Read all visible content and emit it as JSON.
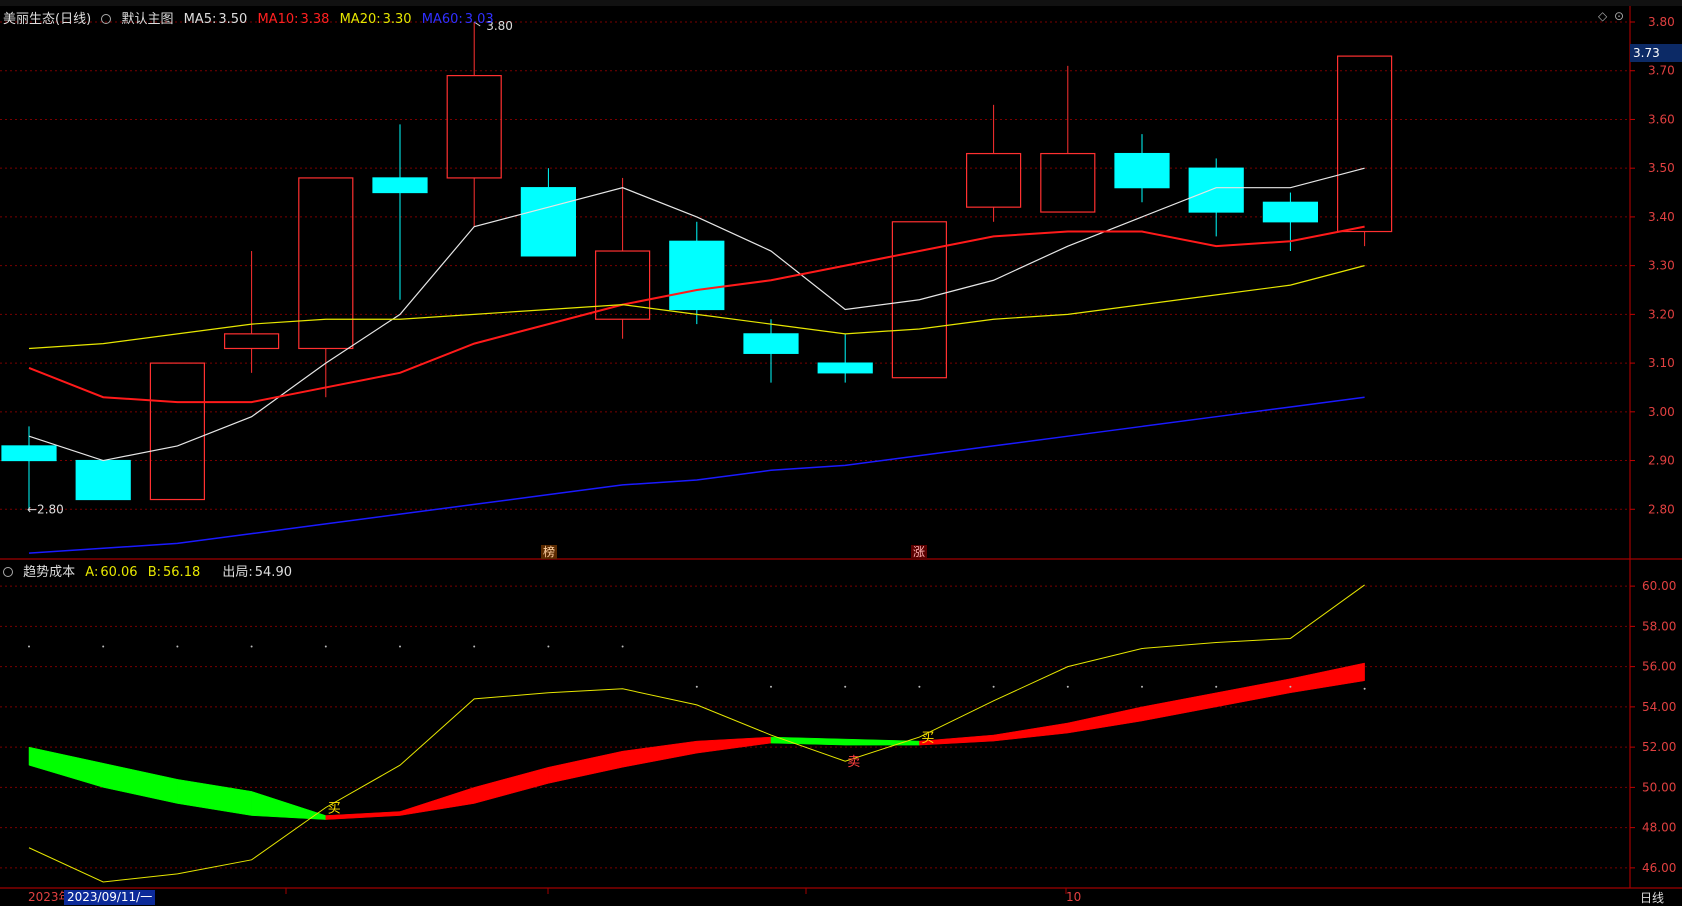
{
  "top_header": {
    "stock": "美丽生态(日线)",
    "template": "默认主图",
    "ma5_label": "MA5:",
    "ma5": "3.50",
    "ma10_label": "MA10:",
    "ma10": "3.38",
    "ma20_label": "MA20:",
    "ma20": "3.30",
    "ma60_label": "MA60:",
    "ma60": "3.03"
  },
  "bottom_header": {
    "indicator": "趋势成本",
    "a_label": "A:",
    "a": "60.06",
    "b_label": "B:",
    "b": "56.18",
    "exit_label": "出局:",
    "exit": "54.90"
  },
  "current_price_tag": "3.73",
  "date_labels": {
    "year_left": "2023年",
    "selected_date": "2023/09/11/一",
    "month_mark": "10"
  },
  "period_button": "日线",
  "annotations": {
    "high": "3.80",
    "low": "2.80",
    "mark1": "榜",
    "mark2": "涨"
  },
  "colors": {
    "up": "#ff3030",
    "down": "#00ffff",
    "ma5": "#e6e6e6",
    "ma10": "#ff1a1a",
    "ma20": "#e6e600",
    "ma60": "#1a1aff",
    "band_up": "#ff0000",
    "band_down": "#00ff00",
    "grid": "#7a0000",
    "axis_text": "#e04040"
  },
  "chart_data": [
    {
      "type": "candlestick",
      "title": "美丽生态(日线)",
      "ylim": [
        2.7,
        3.8
      ],
      "y_ticks": [
        "3.80",
        "3.70",
        "3.60",
        "3.50",
        "3.40",
        "3.30",
        "3.20",
        "3.10",
        "3.00",
        "2.90",
        "2.80"
      ],
      "candles": [
        {
          "open": 2.93,
          "close": 2.9,
          "high": 2.97,
          "low": 2.8
        },
        {
          "open": 2.9,
          "close": 2.82,
          "high": 2.9,
          "low": 2.82
        },
        {
          "open": 2.82,
          "close": 3.1,
          "high": 3.1,
          "low": 2.82
        },
        {
          "open": 3.13,
          "close": 3.16,
          "high": 3.33,
          "low": 3.08
        },
        {
          "open": 3.13,
          "close": 3.48,
          "high": 3.48,
          "low": 3.03
        },
        {
          "open": 3.48,
          "close": 3.45,
          "high": 3.59,
          "low": 3.23
        },
        {
          "open": 3.48,
          "close": 3.69,
          "high": 3.8,
          "low": 3.38
        },
        {
          "open": 3.46,
          "close": 3.32,
          "high": 3.5,
          "low": 3.32
        },
        {
          "open": 3.19,
          "close": 3.33,
          "high": 3.48,
          "low": 3.15
        },
        {
          "open": 3.35,
          "close": 3.21,
          "high": 3.39,
          "low": 3.18
        },
        {
          "open": 3.16,
          "close": 3.12,
          "high": 3.19,
          "low": 3.06
        },
        {
          "open": 3.1,
          "close": 3.08,
          "high": 3.16,
          "low": 3.06
        },
        {
          "open": 3.07,
          "close": 3.39,
          "high": 3.39,
          "low": 3.07
        },
        {
          "open": 3.42,
          "close": 3.53,
          "high": 3.63,
          "low": 3.39
        },
        {
          "open": 3.41,
          "close": 3.53,
          "high": 3.71,
          "low": 3.41
        },
        {
          "open": 3.53,
          "close": 3.46,
          "high": 3.57,
          "low": 3.43
        },
        {
          "open": 3.5,
          "close": 3.41,
          "high": 3.52,
          "low": 3.36
        },
        {
          "open": 3.43,
          "close": 3.39,
          "high": 3.45,
          "low": 3.33
        },
        {
          "open": 3.37,
          "close": 3.73,
          "high": 3.73,
          "low": 3.34
        }
      ],
      "series": [
        {
          "name": "MA5",
          "values": [
            2.95,
            2.9,
            2.93,
            2.99,
            3.1,
            3.2,
            3.38,
            3.42,
            3.46,
            3.4,
            3.33,
            3.21,
            3.23,
            3.27,
            3.34,
            3.4,
            3.46,
            3.46,
            3.5
          ]
        },
        {
          "name": "MA10",
          "values": [
            3.09,
            3.03,
            3.02,
            3.02,
            3.05,
            3.08,
            3.14,
            3.18,
            3.22,
            3.25,
            3.27,
            3.3,
            3.33,
            3.36,
            3.37,
            3.37,
            3.34,
            3.35,
            3.38
          ]
        },
        {
          "name": "MA20",
          "values": [
            3.13,
            3.14,
            3.16,
            3.18,
            3.19,
            3.19,
            3.2,
            3.21,
            3.22,
            3.2,
            3.18,
            3.16,
            3.17,
            3.19,
            3.2,
            3.22,
            3.24,
            3.26,
            3.3
          ]
        },
        {
          "name": "MA60",
          "values": [
            2.71,
            2.72,
            2.73,
            2.75,
            2.77,
            2.79,
            2.81,
            2.83,
            2.85,
            2.86,
            2.88,
            2.89,
            2.91,
            2.93,
            2.95,
            2.97,
            2.99,
            3.01,
            3.03
          ]
        }
      ]
    },
    {
      "type": "line",
      "title": "趋势成本",
      "ylim": [
        45,
        61
      ],
      "y_ticks": [
        "60.00",
        "58.00",
        "56.00",
        "54.00",
        "52.00",
        "50.00",
        "48.00",
        "46.00"
      ],
      "series": [
        {
          "name": "A",
          "values": [
            47.0,
            45.3,
            45.7,
            46.4,
            49.0,
            51.1,
            54.4,
            54.7,
            54.9,
            54.1,
            52.6,
            51.3,
            52.5,
            54.3,
            56.0,
            56.9,
            57.2,
            57.4,
            60.06
          ]
        },
        {
          "name": "B_upper",
          "values": [
            52.0,
            51.2,
            50.4,
            49.8,
            48.6,
            48.8,
            50.0,
            51.0,
            51.8,
            52.3,
            52.5,
            52.4,
            52.3,
            52.6,
            53.2,
            54.0,
            54.7,
            55.4,
            56.18
          ]
        },
        {
          "name": "B_lower",
          "values": [
            51.1,
            50.0,
            49.2,
            48.6,
            48.4,
            48.6,
            49.2,
            50.2,
            51.0,
            51.7,
            52.2,
            52.1,
            52.1,
            52.3,
            52.7,
            53.3,
            54.0,
            54.7,
            55.3
          ]
        }
      ],
      "dots_values": [
        57.0,
        57.0,
        57.0,
        57.0,
        57.0,
        57.0,
        57.0,
        57.0,
        57.0,
        55.0,
        55.0,
        55.0,
        55.0,
        55.0,
        55.0,
        55.0,
        55.0,
        55.0,
        54.9
      ],
      "signals": [
        {
          "index": 4,
          "text": "买"
        },
        {
          "index": 11,
          "text": "卖"
        },
        {
          "index": 12,
          "text": "买"
        }
      ]
    }
  ]
}
